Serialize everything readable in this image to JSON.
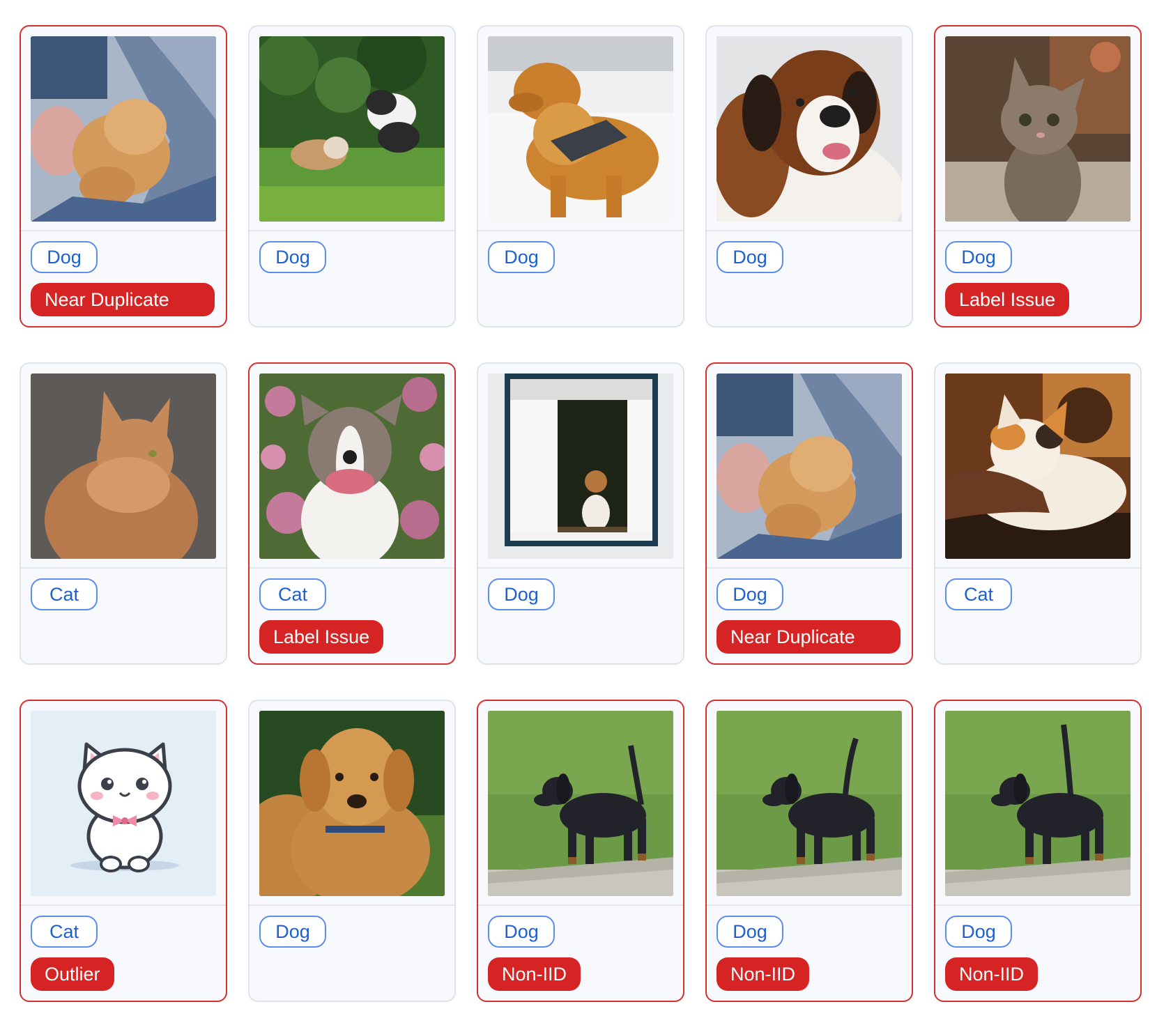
{
  "colors": {
    "flag_border": "#d62f2f",
    "badge_red": "#d62424",
    "chip_border": "#5b8dee",
    "chip_text": "#1f5fcf",
    "card_border": "#dfe3ea",
    "card_bg": "#f7f9fc"
  },
  "cards": [
    {
      "image": "puppy-held-in-arms-photo",
      "label": "Dog",
      "issue": "Near Duplicate"
    },
    {
      "image": "two-dogs-playing-on-grass-photo",
      "label": "Dog",
      "issue": ""
    },
    {
      "image": "golden-retriever-in-snow-photo",
      "label": "Dog",
      "issue": ""
    },
    {
      "image": "saint-bernard-portrait-photo",
      "label": "Dog",
      "issue": ""
    },
    {
      "image": "tabby-kitten-photo",
      "label": "Dog",
      "issue": "Label Issue"
    },
    {
      "image": "orange-long-haired-cat-photo",
      "label": "Cat",
      "issue": ""
    },
    {
      "image": "pitbull-in-flowers-photo",
      "label": "Cat",
      "issue": "Label Issue"
    },
    {
      "image": "beagle-in-window-photo",
      "label": "Dog",
      "issue": ""
    },
    {
      "image": "puppy-held-in-arms-photo",
      "label": "Dog",
      "issue": "Near Duplicate"
    },
    {
      "image": "calico-cat-being-petted-photo",
      "label": "Cat",
      "issue": ""
    },
    {
      "image": "cartoon-white-cat-illustration",
      "label": "Cat",
      "issue": "Outlier"
    },
    {
      "image": "golden-retriever-puppy-photo",
      "label": "Dog",
      "issue": ""
    },
    {
      "image": "dachshund-walking-on-grass-photo",
      "label": "Dog",
      "issue": "Non-IID"
    },
    {
      "image": "dachshund-walking-on-grass-photo",
      "label": "Dog",
      "issue": "Non-IID"
    },
    {
      "image": "dachshund-walking-on-grass-photo",
      "label": "Dog",
      "issue": "Non-IID"
    }
  ]
}
